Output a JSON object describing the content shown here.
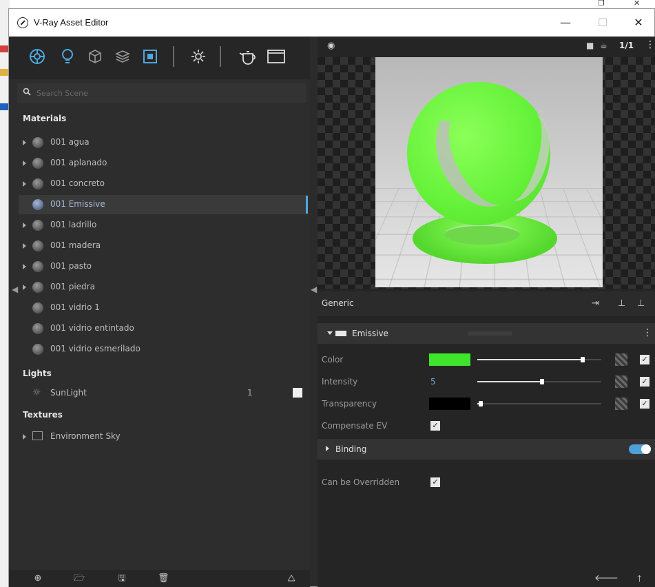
{
  "window": {
    "title": "V-Ray Asset Editor",
    "min_symbol": "—",
    "max_symbol": "☐",
    "close_symbol": "✕"
  },
  "toolbar": {
    "icons": [
      "materials-icon",
      "lights-icon",
      "geometry-icon",
      "render-elements-icon",
      "textures-icon",
      "settings-icon",
      "teapot-render-icon",
      "frame-buffer-icon"
    ]
  },
  "search": {
    "placeholder": "Search Scene"
  },
  "sections": {
    "materials": "Materials",
    "lights": "Lights",
    "textures": "Textures"
  },
  "materials": [
    {
      "name": "001 agua",
      "expandable": true
    },
    {
      "name": "001 aplanado",
      "expandable": true
    },
    {
      "name": "001 concreto",
      "expandable": true
    },
    {
      "name": "001 Emissive",
      "expandable": false,
      "selected": true
    },
    {
      "name": "001 ladrillo",
      "expandable": true
    },
    {
      "name": "001 madera",
      "expandable": true
    },
    {
      "name": "001 pasto",
      "expandable": true
    },
    {
      "name": "001 piedra",
      "expandable": true
    },
    {
      "name": "001 vidrio 1",
      "expandable": false
    },
    {
      "name": "001 vidrio entintado",
      "expandable": false
    },
    {
      "name": "001 vidrio esmerilado",
      "expandable": false
    }
  ],
  "lights": [
    {
      "name": "SunLight",
      "count": "1"
    }
  ],
  "textures": [
    {
      "name": "Environment Sky"
    }
  ],
  "preview": {
    "resolution_label": "1/1",
    "swatch_color": "#66f23a"
  },
  "properties": {
    "header": "Generic",
    "group": "Emissive",
    "color_label": "Color",
    "color_value": "#3ee52a",
    "color_slider": 0.85,
    "intensity_label": "Intensity",
    "intensity_value": "5",
    "intensity_slider": 0.52,
    "transparency_label": "Transparency",
    "transparency_value": "#000000",
    "transparency_slider": 0.03,
    "compensate_label": "Compensate EV",
    "binding_label": "Binding",
    "override_label": "Can be Overridden"
  },
  "colors": {
    "accent": "#4fa8e0",
    "emissive_green": "#3ee52a"
  }
}
